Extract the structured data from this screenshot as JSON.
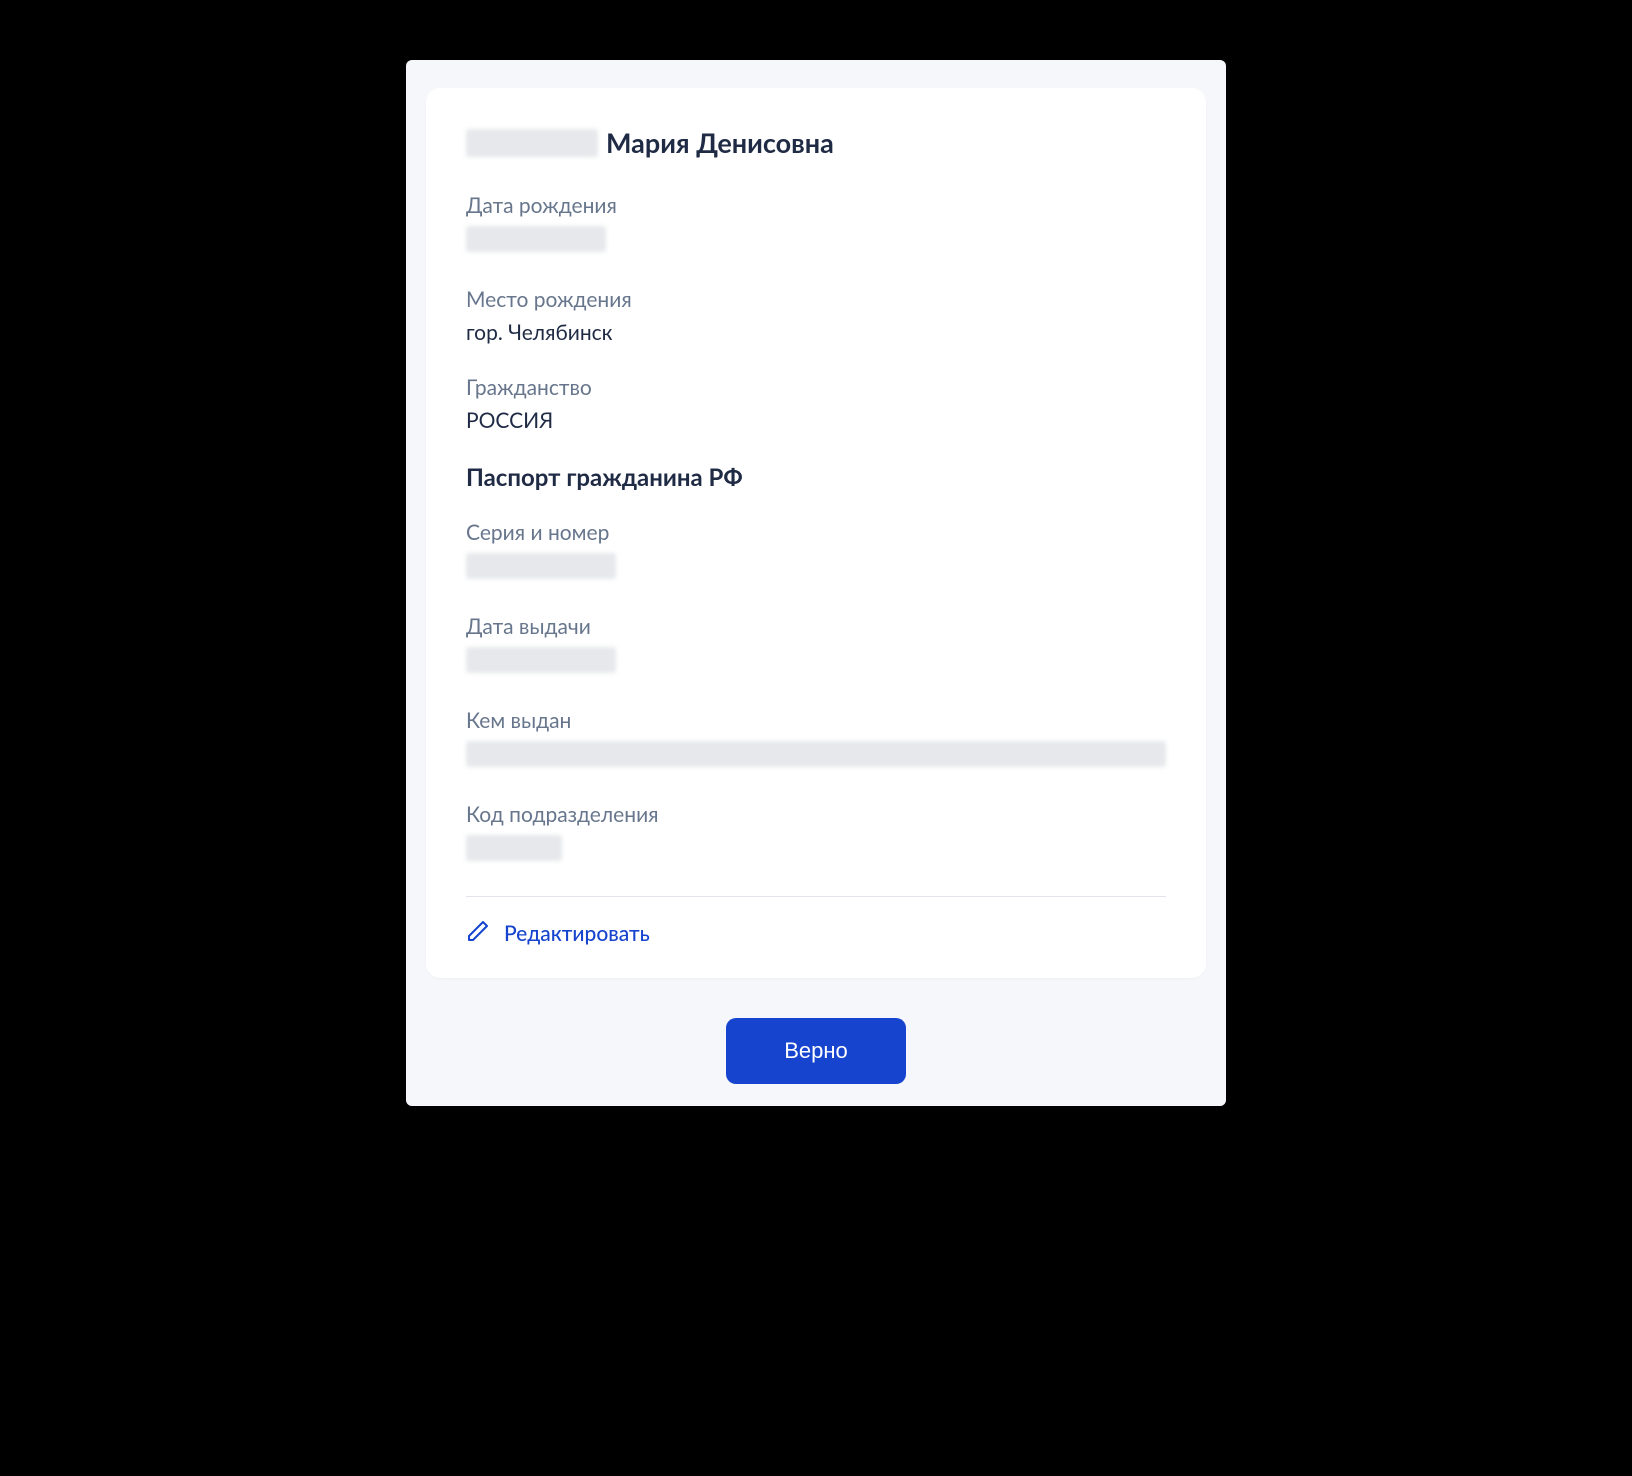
{
  "person": {
    "name_visible": "Мария Денисовна",
    "birth_date_label": "Дата рождения",
    "birth_place_label": "Место рождения",
    "birth_place_value": "гор. Челябинск",
    "citizenship_label": "Гражданство",
    "citizenship_value": "РОССИЯ"
  },
  "passport": {
    "section_title": "Паспорт гражданина РФ",
    "series_number_label": "Серия и номер",
    "issue_date_label": "Дата выдачи",
    "issued_by_label": "Кем выдан",
    "department_code_label": "Код подразделения"
  },
  "actions": {
    "edit_label": "Редактировать",
    "confirm_label": "Верно"
  },
  "colors": {
    "page_bg": "#f5f7fa",
    "card_bg": "#ffffff",
    "text_primary": "#1f2a44",
    "text_muted": "#67768c",
    "accent": "#1644cf",
    "redacted": "#e6e8eb"
  }
}
